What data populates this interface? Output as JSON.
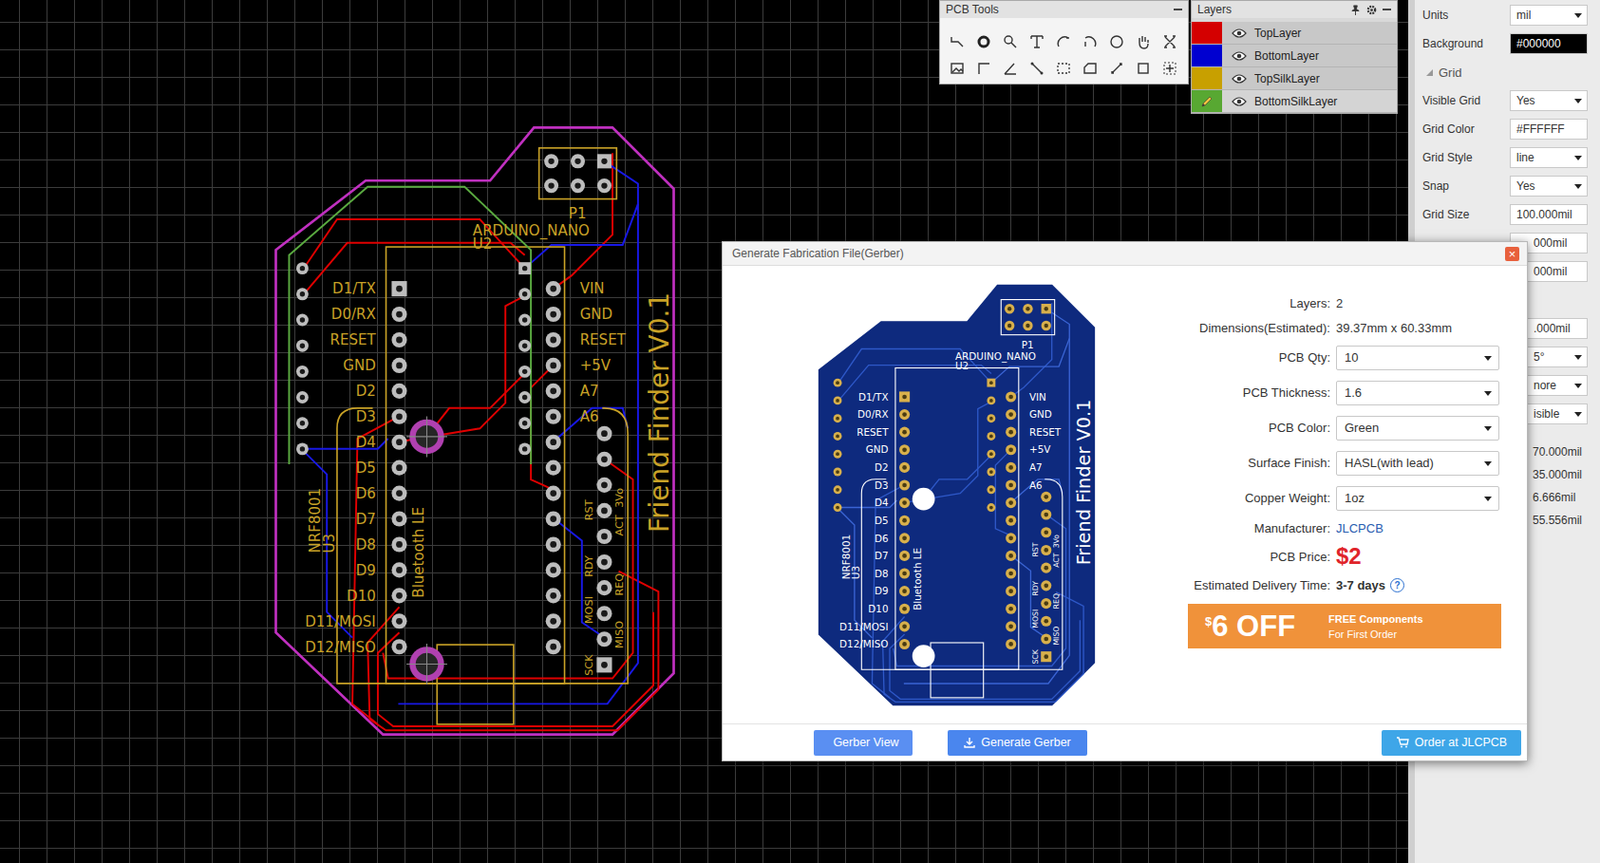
{
  "toolbox": {
    "title": "PCB Tools"
  },
  "layers": {
    "title": "Layers",
    "items": [
      {
        "name": "TopLayer",
        "color": "#d40000",
        "visible": true,
        "active": false
      },
      {
        "name": "BottomLayer",
        "color": "#0000d0",
        "visible": true,
        "active": false
      },
      {
        "name": "TopSilkLayer",
        "color": "#c8a000",
        "visible": true,
        "active": false
      },
      {
        "name": "BottomSilkLayer",
        "color": "#58a832",
        "visible": true,
        "active": true
      }
    ]
  },
  "properties": {
    "rows": [
      {
        "label": "Units",
        "value": "mil",
        "kind": "select"
      },
      {
        "label": "Background",
        "value": "#000000",
        "kind": "swatch"
      },
      {
        "label": "Grid",
        "kind": "section"
      },
      {
        "label": "Visible Grid",
        "value": "Yes",
        "kind": "select"
      },
      {
        "label": "Grid Color",
        "value": "#FFFFFF",
        "kind": "input"
      },
      {
        "label": "Grid Style",
        "value": "line",
        "kind": "select"
      },
      {
        "label": "Snap",
        "value": "Yes",
        "kind": "select"
      },
      {
        "label": "Grid Size",
        "value": "100.000mil",
        "kind": "input"
      },
      {
        "value": "000mil",
        "kind": "input-cut"
      },
      {
        "value": "000mil",
        "kind": "input-cut"
      },
      {
        "value": ".000mil",
        "kind": "input-cut"
      },
      {
        "value": "5°",
        "kind": "select-cut"
      },
      {
        "value": "nore",
        "kind": "select-cut"
      },
      {
        "value": "isible",
        "kind": "select-cut"
      },
      {
        "value": "70.000mil",
        "kind": "plain-cut"
      },
      {
        "value": "35.000mil",
        "kind": "plain-cut"
      },
      {
        "value": "6.666mil",
        "kind": "plain-cut"
      },
      {
        "value": "55.556mil",
        "kind": "plain-cut"
      }
    ]
  },
  "board": {
    "left_pins": [
      "D1/TX",
      "D0/RX",
      "RESET",
      "GND",
      "D2",
      "D3",
      "D4",
      "D5",
      "D6",
      "D7",
      "D8",
      "D9",
      "D10",
      "D11/MOSI",
      "D12/MISO"
    ],
    "right_pins": [
      "VIN",
      "GND",
      "RESET",
      "+5V",
      "A7",
      "A6"
    ],
    "module_pins": [
      "3Vo",
      "RST",
      "ACT",
      "RDY",
      "REQ",
      "MOSI",
      "MISO",
      "SCK"
    ],
    "refs": {
      "p1": "P1",
      "nano": "ARDUINO_NANO",
      "u2": "U2",
      "nrf": "NRF8001",
      "u3": "U3",
      "ble": "Bluetooth LE",
      "title": "Friend Finder V0.1"
    }
  },
  "dialog": {
    "title": "Generate Fabrication File(Gerber)",
    "close": "×",
    "fields": [
      {
        "label": "Layers:",
        "value": "2",
        "kind": "text"
      },
      {
        "label": "Dimensions(Estimated):",
        "value": "39.37mm x 60.33mm",
        "kind": "text"
      },
      {
        "label": "PCB Qty:",
        "value": "10",
        "kind": "select"
      },
      {
        "label": "PCB Thickness:",
        "value": "1.6",
        "kind": "select"
      },
      {
        "label": "PCB Color:",
        "value": "Green",
        "kind": "select"
      },
      {
        "label": "Surface Finish:",
        "value": "HASL(with lead)",
        "kind": "select"
      },
      {
        "label": "Copper Weight:",
        "value": "1oz",
        "kind": "select"
      },
      {
        "label": "Manufacturer:",
        "value": "JLCPCB",
        "kind": "link"
      },
      {
        "label": "PCB Price:",
        "value": "$2",
        "kind": "price"
      },
      {
        "label": "Estimated Delivery Time:",
        "value": "3-7 days",
        "kind": "help",
        "help": "?"
      }
    ],
    "banner": {
      "currency": "$",
      "amount": "6 OFF",
      "line1": "FREE Components",
      "line2": "For First Order"
    },
    "buttons": [
      {
        "label": "Gerber View",
        "kind": "plain",
        "color": "#5a8ff2"
      },
      {
        "label": "Generate Gerber",
        "kind": "download",
        "color": "#4a86ee"
      },
      {
        "label": "Order at JLCPCB",
        "kind": "cart",
        "color": "#3ea6e8"
      }
    ]
  }
}
